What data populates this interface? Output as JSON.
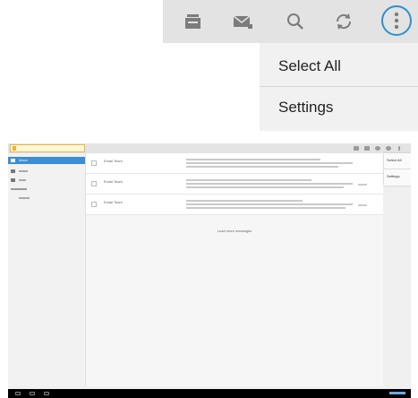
{
  "callout": {
    "menu_items": [
      "Select All",
      "Settings"
    ],
    "icons": [
      "compose-icon",
      "mail-icon",
      "search-icon",
      "refresh-icon",
      "overflow-menu-icon"
    ],
    "highlight_color": "#2f8fd0"
  },
  "tablet": {
    "account": "",
    "sidebar": [
      {
        "label": "Inbox",
        "active": true
      },
      {
        "label": "",
        "active": false
      },
      {
        "label": "",
        "active": false
      },
      {
        "label": "",
        "active": false
      },
      {
        "label": "",
        "active": false
      }
    ],
    "messages": [
      {
        "from": "Email Team",
        "subject": "",
        "date": ""
      },
      {
        "from": "Email Team",
        "subject": "",
        "date": ""
      },
      {
        "from": "Email Team",
        "subject": "",
        "date": ""
      }
    ],
    "load_more": "Load more messages",
    "menu": [
      "Select All",
      "Settings"
    ],
    "accent": "#3a8ed8"
  }
}
